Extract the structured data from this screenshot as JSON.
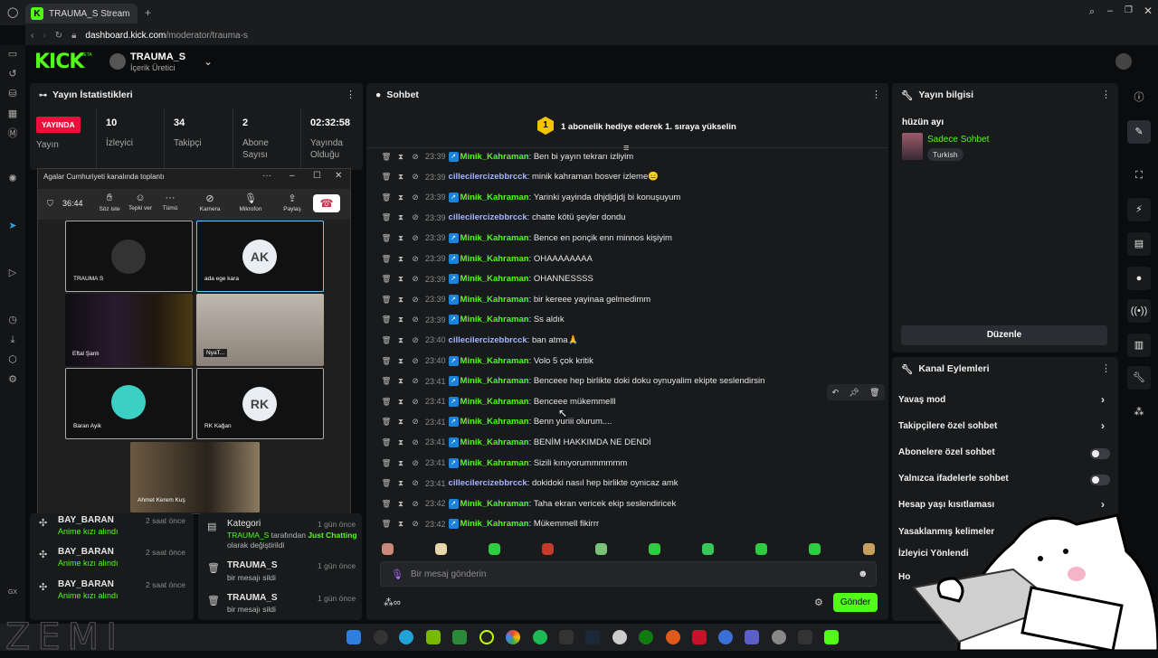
{
  "browser": {
    "tab_title": "TRAUMA_S Stream - Kick",
    "url_host": "dashboard.kick.com",
    "url_path": "/moderator/trauma-s"
  },
  "header": {
    "logo": "KICK",
    "logo_badge": "BETA",
    "channel_name": "TRAUMA_S",
    "channel_role": "İçerik Üretici"
  },
  "stats": {
    "title": "Yayın İstatistikleri",
    "live_badge": "YAYINDA",
    "live_label": "Yayın",
    "items": [
      {
        "value": "10",
        "label": "İzleyici"
      },
      {
        "value": "34",
        "label": "Takipçi"
      },
      {
        "value": "2",
        "label": "Abone Sayısı"
      },
      {
        "value": "02:32:58",
        "label": "Yayında Olduğu Süre"
      }
    ]
  },
  "teams": {
    "title": "Agalar Cumhuriyeti kanalında toplantı",
    "timer": "36:44",
    "buttons": [
      "Söz iste",
      "Tepki ver",
      "Tümü",
      "Kamera",
      "Mikrofon",
      "Paylaş"
    ],
    "participants": [
      {
        "name": "TRAUMA S"
      },
      {
        "name": "ada ege kara",
        "initials": "AK"
      },
      {
        "name": "Eftal Şanlı"
      },
      {
        "name": "NyaT..."
      },
      {
        "name": "Baran Ayik"
      },
      {
        "name": "RK Kağan",
        "initials": "RK"
      },
      {
        "name": "Ahmet Kerem Kuş"
      }
    ]
  },
  "activity": [
    {
      "user": "BAY_BARAN",
      "event": "Anime kızı alındı",
      "time": "2 saat önce"
    },
    {
      "user": "BAY_BARAN",
      "event": "Anime kızı alındı",
      "time": "2 saat önce"
    },
    {
      "user": "BAY_BARAN",
      "event": "Anime kızı alındı",
      "time": "2 saat önce"
    }
  ],
  "modlog": [
    {
      "title": "Kategori",
      "line1_user": "TRAUMA_S",
      "line1_text": " tarafından ",
      "line1_value": "Just Chatting",
      "line2": "olarak değiştirildi",
      "time": "1 gün önce"
    },
    {
      "title": "TRAUMA_S",
      "line2": "bir mesajı sildi",
      "time": "1 gün önce"
    },
    {
      "title": "TRAUMA_S",
      "line2": "bir mesajı sildi",
      "time": "1 gün önce"
    }
  ],
  "chat": {
    "title": "Sohbet",
    "gift_rank": "1",
    "gift_text": "1 abonelik hediye ederek 1. sıraya yükselin",
    "messages": [
      {
        "time": "23:39",
        "user": "Minik_Kahraman",
        "text": "Ben bi yayın tekrarı izliyim",
        "kind": "sub"
      },
      {
        "time": "23:39",
        "user": "cillecilercizebbrcck",
        "text": "minik kahraman bosver izleme😑",
        "kind": "plain"
      },
      {
        "time": "23:39",
        "user": "Minik_Kahraman",
        "text": "Yarinki yayinda dhjdjdjdj bi konuşuyum",
        "kind": "sub"
      },
      {
        "time": "23:39",
        "user": "cillecilercizebbrcck",
        "text": "chatte kötü şeyler dondu",
        "kind": "plain"
      },
      {
        "time": "23:39",
        "user": "Minik_Kahraman",
        "text": "Bence en ponçik enn minnos kişiyim",
        "kind": "sub"
      },
      {
        "time": "23:39",
        "user": "Minik_Kahraman",
        "text": "OHAAAAAAAA",
        "kind": "sub"
      },
      {
        "time": "23:39",
        "user": "Minik_Kahraman",
        "text": "OHANNESSSS",
        "kind": "sub"
      },
      {
        "time": "23:39",
        "user": "Minik_Kahraman",
        "text": "bir kereee yayinaa gelmedimm",
        "kind": "sub"
      },
      {
        "time": "23:39",
        "user": "Minik_Kahraman",
        "text": "Ss aldık",
        "kind": "sub"
      },
      {
        "time": "23:40",
        "user": "cillecilercizebbrcck",
        "text": "ban atma🙏",
        "kind": "plain"
      },
      {
        "time": "23:40",
        "user": "Minik_Kahraman",
        "text": "Volo 5 çok kritik",
        "kind": "sub"
      },
      {
        "time": "23:41",
        "user": "Minik_Kahraman",
        "text": "Benceee hep birlikte doki doku oynuyalim ekipte seslendirsin",
        "kind": "sub"
      },
      {
        "time": "23:41",
        "user": "Minik_Kahraman",
        "text": "Benceee mükemmelll",
        "kind": "sub"
      },
      {
        "time": "23:41",
        "user": "Minik_Kahraman",
        "text": "Benn yuriii olurum....",
        "kind": "sub"
      },
      {
        "time": "23:41",
        "user": "Minik_Kahraman",
        "text": "BENİM HAKKIMDA NE DENDİ",
        "kind": "sub"
      },
      {
        "time": "23:41",
        "user": "Minik_Kahraman",
        "text": "Sizili kınıyorummmmmm",
        "kind": "sub"
      },
      {
        "time": "23:41",
        "user": "cillecilercizebbrcck",
        "text": "dokidoki nasıl hep birlikte oynicaz amk",
        "kind": "plain"
      },
      {
        "time": "23:42",
        "user": "Minik_Kahraman",
        "text": "Taha ekran vericek ekip seslendiricek",
        "kind": "sub"
      },
      {
        "time": "23:42",
        "user": "Minik_Kahraman",
        "text": "Mükemmell fikirrr",
        "kind": "sub"
      }
    ],
    "input_placeholder": "Bir mesaj gönderin",
    "send_label": "Gönder"
  },
  "stream_info": {
    "title": "Yayın bilgisi",
    "stream_title": "hüzün ayı",
    "category": "Sadece Sohbet",
    "tag": "Turkish",
    "edit_label": "Düzenle"
  },
  "channel_actions": {
    "title": "Kanal Eylemleri",
    "items": [
      {
        "label": "Yavaş mod",
        "control": "chevron"
      },
      {
        "label": "Takipçilere özel sohbet",
        "control": "chevron"
      },
      {
        "label": "Abonelere özel sohbet",
        "control": "toggle"
      },
      {
        "label": "Yalnızca ifadelerle sohbet",
        "control": "toggle"
      },
      {
        "label": "Hesap yaşı kısıtlaması",
        "control": "chevron"
      },
      {
        "label": "Yasaklanmış kelimeler",
        "control": "chevron"
      },
      {
        "label": "İzleyici Yönlendi",
        "control": "none"
      },
      {
        "label": "Ho",
        "control": "none"
      }
    ]
  },
  "colors": {
    "accent": "#53fc18",
    "live": "#e9113c",
    "panel": "#181a1c"
  }
}
